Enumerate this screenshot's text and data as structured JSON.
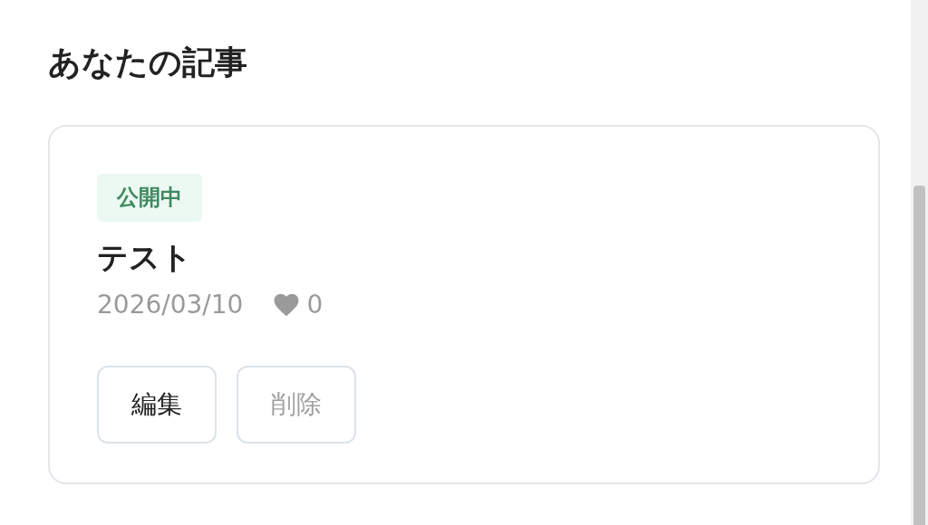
{
  "heading": "あなたの記事",
  "articles": [
    {
      "status": "公開中",
      "title": "テスト",
      "date": "2026/03/10",
      "likes": "0",
      "buttons": [
        {
          "label": "編集",
          "disabled": false
        },
        {
          "label": "削除",
          "disabled": true
        }
      ]
    }
  ]
}
